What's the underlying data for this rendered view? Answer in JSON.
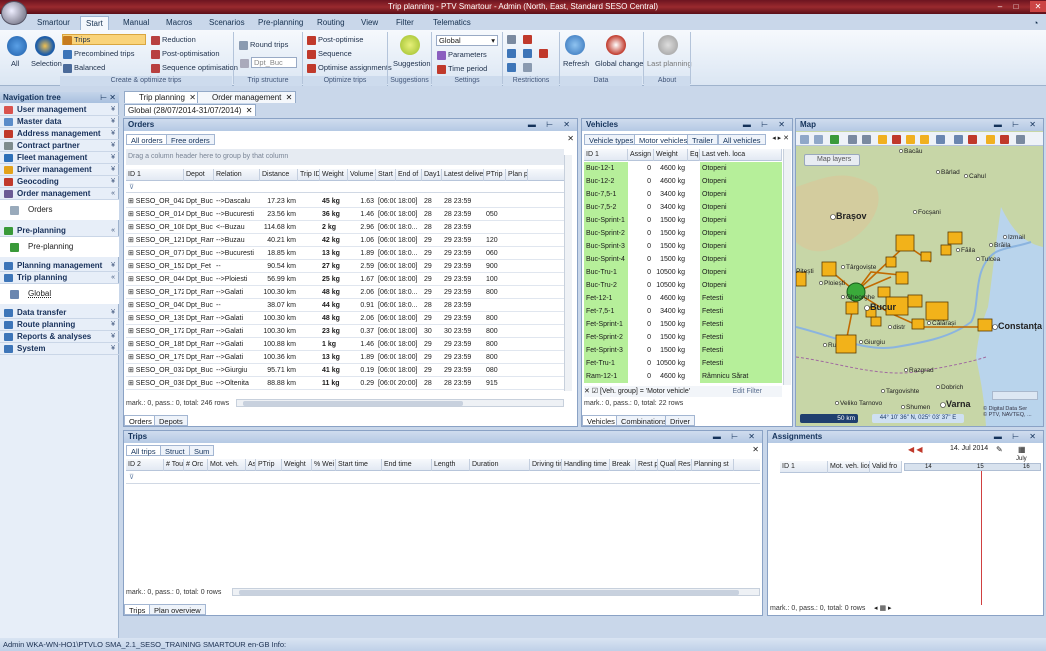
{
  "window": {
    "title": "Trip planning - PTV Smartour - Admin (North, East, Standard SESO Central)"
  },
  "ribbon_tabs": [
    "Smartour",
    "Start",
    "Manual",
    "Macros",
    "Scenarios",
    "Pre-planning",
    "Routing",
    "View",
    "Filter",
    "Telematics"
  ],
  "ribbon": {
    "all": "All",
    "selection": "Selection",
    "trips": "Trips",
    "precombined_trips": "Precombined trips",
    "balanced": "Balanced",
    "reduction": "Reduction",
    "post_optimisation": "Post-optimisation",
    "sequence_optimisation": "Sequence optimisation",
    "round_trips": "Round trips",
    "depot_select": "Dpt_Buc",
    "post_optimise": "Post-optimise",
    "sequence": "Sequence",
    "optimise_assignments": "Optimise assignments",
    "suggestion": "Suggestion",
    "global_select": "Global",
    "parameters": "Parameters",
    "time_period": "Time period",
    "refresh": "Refresh",
    "global_change": "Global change",
    "last_planning": "Last planning",
    "groups": {
      "create": "Create & optimize trips",
      "structure": "Trip structure",
      "optimize": "Optimize trips",
      "suggestions": "Suggestions",
      "settings": "Settings",
      "restrictions": "Restrictions",
      "data": "Data",
      "about": "About"
    }
  },
  "nav": {
    "title": "Navigation tree",
    "items": [
      {
        "label": "User management",
        "color": "#d9534f"
      },
      {
        "label": "Master data",
        "color": "#5b8cc9"
      },
      {
        "label": "Address management",
        "color": "#c0392b"
      },
      {
        "label": "Contract partner",
        "color": "#7f8c8d"
      },
      {
        "label": "Fleet management",
        "color": "#2d6fb7"
      },
      {
        "label": "Driver management",
        "color": "#e3a21a"
      },
      {
        "label": "Geocoding",
        "color": "#c0392b"
      },
      {
        "label": "Order management",
        "color": "#6b5b95"
      },
      {
        "label": "Orders",
        "sub": true
      },
      {
        "label": "Pre-planning",
        "color": "#3a9a3a"
      },
      {
        "label": "Pre-planning",
        "sub": true
      },
      {
        "label": "Planning management",
        "color": "#3d75b8"
      },
      {
        "label": "Trip planning",
        "color": "#3d75b8"
      },
      {
        "label": "Global",
        "sub": true
      },
      {
        "label": "Data transfer",
        "color": "#3d75b8"
      },
      {
        "label": "Route planning",
        "color": "#3d75b8"
      },
      {
        "label": "Reports & analyses",
        "color": "#3d75b8"
      },
      {
        "label": "System",
        "color": "#3d75b8"
      }
    ]
  },
  "doc_tabs": [
    "Trip planning",
    "Order management"
  ],
  "date_tab": "Global (28/07/2014-31/07/2014)",
  "orders": {
    "title": "Orders",
    "tabs": [
      "All orders",
      "Free orders"
    ],
    "group_hint": "Drag a column header here to group by that column",
    "columns": [
      "ID 1",
      "Depot",
      "Relation",
      "Distance",
      "Trip ID",
      "Weight",
      "Volume",
      "Start o",
      "End of",
      "Day1",
      "Latest deliver",
      "PTrip",
      "Plan p"
    ],
    "rows": [
      [
        "SESO_OR_042",
        "Dpt_Buc",
        "-->Dascalu",
        "17.23 km",
        "",
        "45 kg",
        "1.63",
        "[06:00",
        "18:00]",
        "28",
        "28 23:59",
        ""
      ],
      [
        "SESO_OR_014",
        "Dpt_Buc",
        "-->Bucuresti",
        "23.56 km",
        "",
        "36 kg",
        "1.46",
        "[06:00",
        "18:00]",
        "28",
        "28 23:59",
        "050"
      ],
      [
        "SESO_OR_108",
        "Dpt_Buc",
        "<--Buzau",
        "114.68 km",
        "",
        "2 kg",
        "2.96",
        "[06:00",
        "18:0...",
        "28",
        "28 23:59",
        ""
      ],
      [
        "SESO_OR_121",
        "Dpt_Ram",
        "-->Buzau",
        "40.21 km",
        "",
        "42 kg",
        "1.06",
        "[06:00",
        "18:00]",
        "29",
        "29 23:59",
        "120"
      ],
      [
        "SESO_OR_077",
        "Dpt_Buc",
        "-->Bucuresti",
        "18.85 km",
        "",
        "13 kg",
        "1.89",
        "[06:00",
        "18:0...",
        "29",
        "29 23:59",
        "060"
      ],
      [
        "SESO_OR_152",
        "Dpt_Fet",
        "--",
        "90.54 km",
        "",
        "27 kg",
        "2.59",
        "[06:00",
        "18:00]",
        "29",
        "29 23:59",
        "900"
      ],
      [
        "SESO_OR_044",
        "Dpt_Buc",
        "-->Ploiesti",
        "56.99 km",
        "",
        "25 kg",
        "1.67",
        "[06:00",
        "18:00]",
        "29",
        "29 23:59",
        "100"
      ],
      [
        "SESO_OR_172",
        "Dpt_Ram",
        "-->Galati",
        "100.30 km",
        "",
        "48 kg",
        "2.06",
        "[06:00",
        "18:0...",
        "29",
        "29 23:59",
        "800"
      ],
      [
        "SESO_OR_040",
        "Dpt_Buc",
        "--",
        "38.07 km",
        "",
        "44 kg",
        "0.91",
        "[06:00",
        "18:0...",
        "28",
        "28 23:59",
        ""
      ],
      [
        "SESO_OR_139",
        "Dpt_Ram",
        "-->Galati",
        "100.30 km",
        "",
        "48 kg",
        "2.06",
        "[06:00",
        "18:00]",
        "29",
        "29 23:59",
        "800"
      ],
      [
        "SESO_OR_172",
        "Dpt_Ram",
        "-->Galati",
        "100.30 km",
        "",
        "23 kg",
        "0.37",
        "[06:00",
        "18:00]",
        "30",
        "30 23:59",
        "800"
      ],
      [
        "SESO_OR_185",
        "Dpt_Ram",
        "-->Galati",
        "100.88 km",
        "",
        "1 kg",
        "1.46",
        "[06:00",
        "18:00]",
        "29",
        "29 23:59",
        "800"
      ],
      [
        "SESO_OR_179",
        "Dpt_Ram",
        "-->Galati",
        "100.36 km",
        "",
        "13 kg",
        "1.89",
        "[06:00",
        "18:00]",
        "29",
        "29 23:59",
        "800"
      ],
      [
        "SESO_OR_032",
        "Dpt_Buc",
        "-->Giurgiu",
        "95.71 km",
        "",
        "41 kg",
        "0.19",
        "[06:00",
        "18:00]",
        "29",
        "29 23:59",
        "080"
      ],
      [
        "SESO_OR_038",
        "Dpt_Buc",
        "-->Oltenita",
        "88.88 km",
        "",
        "11 kg",
        "0.29",
        "[06:00",
        "20:00]",
        "28",
        "28 23:59",
        "915"
      ]
    ],
    "status": "mark.: 0, pass.: 0, total: 246 rows",
    "bottom_tabs": [
      "Orders",
      "Depots"
    ]
  },
  "vehicles": {
    "title": "Vehicles",
    "tabs": [
      "Vehicle types",
      "Motor vehicles",
      "Trailer",
      "All vehicles"
    ],
    "columns": [
      "ID 1",
      "Assign",
      "Weight",
      "Eq",
      "Last veh. loca"
    ],
    "rows": [
      [
        "Buc-12-1",
        "0",
        "4600 kg",
        "",
        "Otopeni"
      ],
      [
        "Buc-12-2",
        "0",
        "4600 kg",
        "",
        "Otopeni"
      ],
      [
        "Buc-7,5-1",
        "0",
        "3400 kg",
        "",
        "Otopeni"
      ],
      [
        "Buc-7,5-2",
        "0",
        "3400 kg",
        "",
        "Otopeni"
      ],
      [
        "Buc-Sprint-1",
        "0",
        "1500 kg",
        "",
        "Otopeni"
      ],
      [
        "Buc-Sprint-2",
        "0",
        "1500 kg",
        "",
        "Otopeni"
      ],
      [
        "Buc-Sprint-3",
        "0",
        "1500 kg",
        "",
        "Otopeni"
      ],
      [
        "Buc-Sprint-4",
        "0",
        "1500 kg",
        "",
        "Otopeni"
      ],
      [
        "Buc-Tru-1",
        "0",
        "10500 kg",
        "",
        "Otopeni"
      ],
      [
        "Buc-Tru-2",
        "0",
        "10500 kg",
        "",
        "Otopeni"
      ],
      [
        "Fet-12-1",
        "0",
        "4600 kg",
        "",
        "Fetesti"
      ],
      [
        "Fet-7,5-1",
        "0",
        "3400 kg",
        "",
        "Fetesti"
      ],
      [
        "Fet-Sprint-1",
        "0",
        "1500 kg",
        "",
        "Fetesti"
      ],
      [
        "Fet-Sprint-2",
        "0",
        "1500 kg",
        "",
        "Fetesti"
      ],
      [
        "Fet-Sprint-3",
        "0",
        "1500 kg",
        "",
        "Fetesti"
      ],
      [
        "Fet-Tru-1",
        "0",
        "10500 kg",
        "",
        "Fetesti"
      ],
      [
        "Ram-12-1",
        "0",
        "4600 kg",
        "",
        "Râmnicu Sărat"
      ]
    ],
    "filter": "[Veh. group] = 'Motor vehicle'",
    "edit_filter": "Edit Filter",
    "status": "mark.: 0, pass.: 0, total: 22 rows",
    "bottom_tabs": [
      "Vehicles",
      "Combinations",
      "Driver"
    ]
  },
  "map": {
    "title": "Map",
    "layers_btn": "Map layers",
    "scale": "50 km",
    "coords": "44° 10' 36\" N, 025° 03' 37\" E",
    "copyright1": "© Digital Data Ser",
    "copyright2": "© PTV, NAVTEQ, ...",
    "cities": [
      {
        "name": "Bacău",
        "big": false
      },
      {
        "name": "Bârlad",
        "big": false
      },
      {
        "name": "Cahul",
        "big": false
      },
      {
        "name": "Brașov",
        "big": true
      },
      {
        "name": "Focșani",
        "big": false
      },
      {
        "name": "Izmail",
        "big": false
      },
      {
        "name": "Tulcea",
        "big": false
      },
      {
        "name": "Brăila",
        "big": false
      },
      {
        "name": "Pitești",
        "big": false
      },
      {
        "name": "Târgoviște",
        "big": false
      },
      {
        "name": "Ploiești",
        "big": false
      },
      {
        "name": "Gheorghe",
        "big": false
      },
      {
        "name": "Bucur",
        "big": true
      },
      {
        "name": "Călărași",
        "big": false
      },
      {
        "name": "Constanța",
        "big": true
      },
      {
        "name": "Giurgiu",
        "big": false
      },
      {
        "name": "Ru",
        "big": false
      },
      {
        "name": "Razgrad",
        "big": false
      },
      {
        "name": "Dobrich",
        "big": false
      },
      {
        "name": "Targovishte",
        "big": false
      },
      {
        "name": "Veliko Tarnovo",
        "big": false
      },
      {
        "name": "Shumen",
        "big": false
      },
      {
        "name": "Varna",
        "big": true
      },
      {
        "name": "Făila",
        "big": false
      },
      {
        "name": "distr",
        "big": false
      }
    ]
  },
  "trips": {
    "title": "Trips",
    "tabs": [
      "All trips",
      "Struct",
      "Sum"
    ],
    "columns": [
      "ID 2",
      "# Tou",
      "# Orc",
      "Mot. veh.",
      "As",
      "PTrip",
      "Weight",
      "% Wei",
      "Start time",
      "End time",
      "Length",
      "Duration",
      "Driving tim",
      "Handling time",
      "Break",
      "Rest p",
      "Qual",
      "Res",
      "Planning st"
    ],
    "status": "mark.: 0, pass.: 0, total: 0 rows",
    "bottom_tabs": [
      "Trips",
      "Plan overview"
    ]
  },
  "assignments": {
    "title": "Assignments",
    "date": "14. Jul 2014",
    "month": "July",
    "days": [
      "14",
      "15",
      "16"
    ],
    "columns": [
      "ID 1",
      "Mot. veh. lice",
      "Valid fro"
    ],
    "status": "mark.: 0, pass.: 0, total: 0 rows"
  },
  "statusbar": {
    "text": "Admin   WKA-WN-HO1\\PTVLO   SMA_2.1_SESO_TRAINING   SMARTOUR   en-GB   Info:"
  }
}
